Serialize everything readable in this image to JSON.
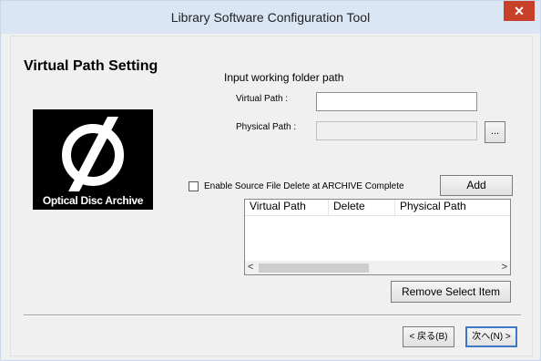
{
  "window": {
    "title": "Library Software Configuration Tool",
    "close_label": "✕"
  },
  "page": {
    "heading": "Virtual Path Setting",
    "logo_text": "Optical Disc Archive"
  },
  "form": {
    "section_label": "Input working folder path",
    "virtual_path_label": "Virtual Path :",
    "virtual_path_value": "",
    "physical_path_label": "Physical Path :",
    "physical_path_value": "",
    "browse_label": "...",
    "checkbox_label": "Enable Source File Delete at ARCHIVE Complete",
    "checkbox_checked": false,
    "add_label": "Add"
  },
  "table": {
    "columns": [
      "Virtual Path",
      "Delete",
      "Physical Path"
    ],
    "rows": [],
    "scroll_left": "<",
    "scroll_right": ">"
  },
  "actions": {
    "remove_label": "Remove Select Item",
    "back_label": "< 戻る(B)",
    "next_label": "次へ(N) >"
  },
  "colors": {
    "title_bar": "#dae6f3",
    "close_button": "#c7402a",
    "logo_background": "#000000"
  }
}
